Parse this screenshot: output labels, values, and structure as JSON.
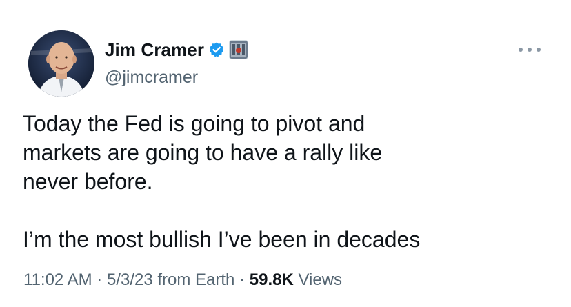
{
  "author": {
    "display_name": "Jim Cramer",
    "handle": "@jimcramer",
    "verified_icon": "verified-badge-icon",
    "affiliate_icon": "affiliate-badge-icon"
  },
  "tweet": {
    "text": "Today the Fed is going to pivot and\nmarkets are going to have a rally like\nnever before.\n\nI’m the most bullish I’ve been in decades"
  },
  "meta": {
    "time": "11:02 AM",
    "separator": "·",
    "date": "5/3/23",
    "source": "from Earth",
    "views_count": "59.8K",
    "views_label": "Views"
  },
  "colors": {
    "verified_blue": "#1d9bf0",
    "secondary_text": "#536471",
    "primary_text": "#0f1419"
  }
}
